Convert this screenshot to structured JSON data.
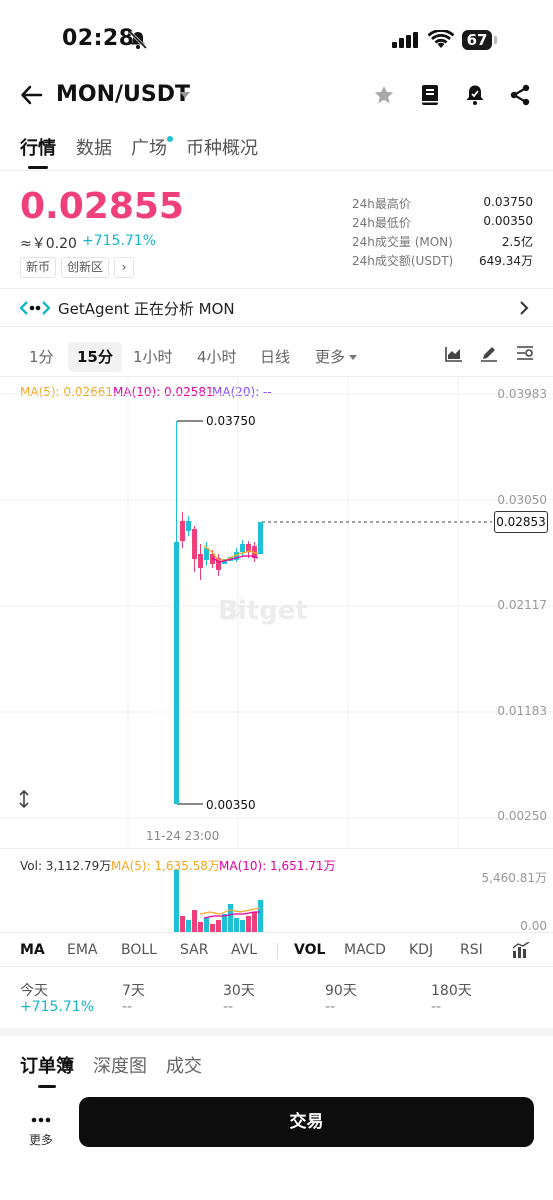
{
  "status": {
    "time": "02:28",
    "battery": "67"
  },
  "header": {
    "pair": "MON/USDT"
  },
  "tabs": [
    {
      "label": "行情"
    },
    {
      "label": "数据"
    },
    {
      "label": "广场"
    },
    {
      "label": "币种概况"
    }
  ],
  "price": {
    "last": "0.02855",
    "cny": "≈￥0.20",
    "change": "+715.71%",
    "tags": [
      "新币",
      "创新区"
    ]
  },
  "stats": [
    {
      "label": "24h最高价",
      "value": "0.03750"
    },
    {
      "label": "24h最低价",
      "value": "0.00350"
    },
    {
      "label": "24h成交量 (MON)",
      "value": "2.5亿"
    },
    {
      "label": "24h成交额(USDT)",
      "value": "649.34万"
    }
  ],
  "agent": {
    "text": "GetAgent 正在分析 MON"
  },
  "intervals": [
    "1分",
    "15分",
    "1小时",
    "4小时",
    "日线",
    "更多"
  ],
  "chart": {
    "ma5": "MA(5): 0.02661",
    "ma10": "MA(10): 0.02581",
    "ma20": "MA(20): --",
    "axis": [
      "0.03983",
      "0.03050",
      "0.02117",
      "0.01183",
      "0.00250"
    ],
    "current": "0.02853",
    "high_ann": "0.03750",
    "low_ann": "0.00350",
    "time_label": "11-24 23:00",
    "watermark": "Bitget",
    "colors": {
      "up": "#1ec0d6",
      "down": "#f0407c",
      "ma5": "#f5a623",
      "ma10": "#e600a0",
      "ma20": "#8a4dff"
    }
  },
  "volume": {
    "vol": "Vol: 3,112.79万",
    "ma5": "MA(5): 1,635.58万",
    "ma10": "MA(10): 1,651.71万",
    "axis_top": "5,460.81万",
    "axis_bottom": "0.00"
  },
  "indicators_main": [
    "MA",
    "EMA",
    "BOLL",
    "SAR",
    "AVL"
  ],
  "indicators_sub": [
    "VOL",
    "MACD",
    "KDJ",
    "RSI"
  ],
  "performance": [
    {
      "label": "今天",
      "value": "+715.71%"
    },
    {
      "label": "7天",
      "value": "--"
    },
    {
      "label": "30天",
      "value": "--"
    },
    {
      "label": "90天",
      "value": "--"
    },
    {
      "label": "180天",
      "value": "--"
    }
  ],
  "bottom_tabs": [
    "订单簿",
    "深度图",
    "成交"
  ],
  "footer": {
    "more": "更多",
    "trade": "交易"
  }
}
